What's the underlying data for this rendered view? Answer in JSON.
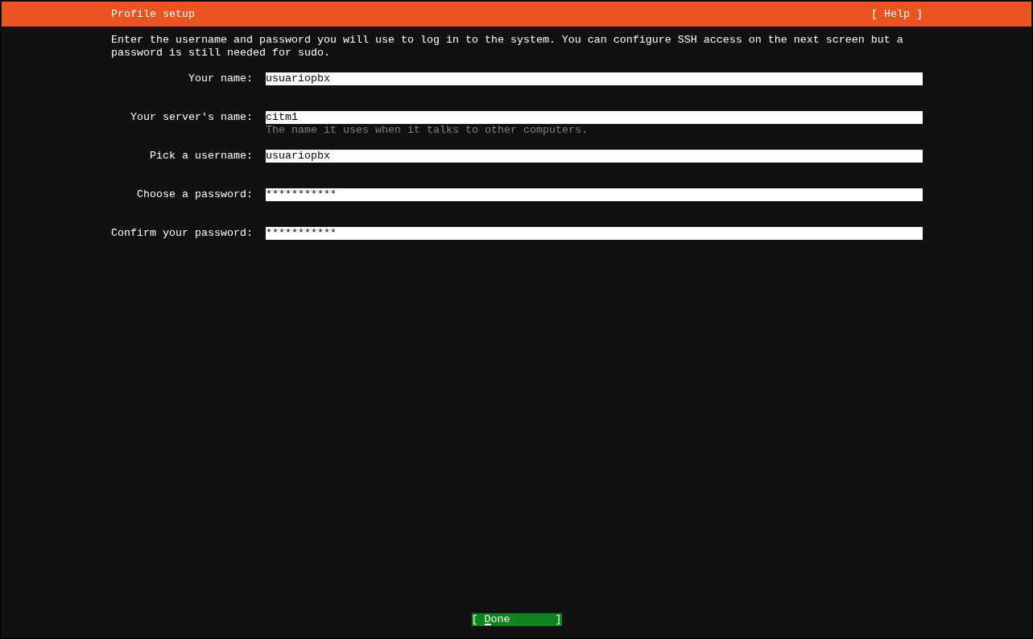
{
  "header": {
    "title": "Profile setup",
    "help": "[ Help ]"
  },
  "description": "Enter the username and password you will use to log in to the system. You can configure SSH access on the next screen but a password is still needed for sudo.",
  "fields": [
    {
      "label": "Your name:",
      "value": "usuariopbx"
    },
    {
      "label": "Your server's name:",
      "value": "citm1",
      "help": "The name it uses when it talks to other computers."
    },
    {
      "label": "Pick a username:",
      "value": "usuariopbx"
    },
    {
      "label": "Choose a password:",
      "value": "***********"
    },
    {
      "label": "Confirm your password:",
      "value": "***********"
    }
  ],
  "done_button": {
    "left": "[",
    "label": "Done",
    "right": "]",
    "focused": true
  }
}
